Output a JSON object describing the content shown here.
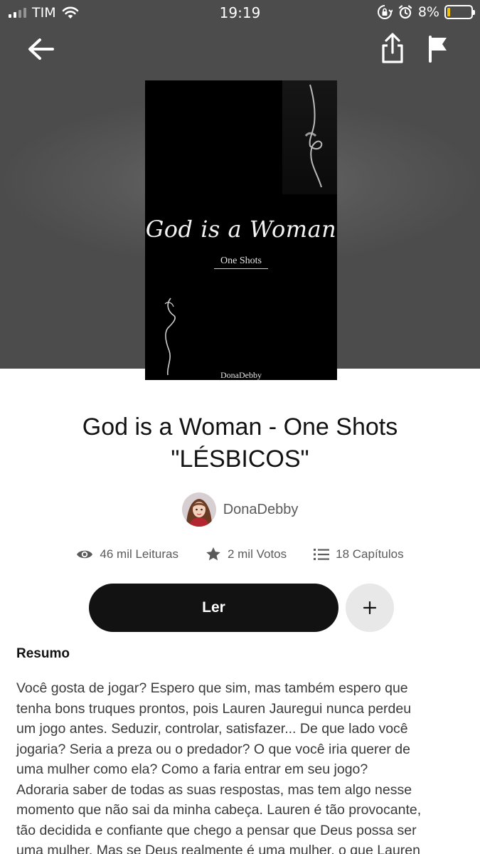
{
  "status_bar": {
    "carrier": "TIM",
    "time": "19:19",
    "battery_percent": "8%",
    "battery_level": 0.08,
    "signal_bars": 2,
    "accent_battery": "#f2c200"
  },
  "toolbar": {
    "back_icon": "arrow-left-icon",
    "share_icon": "share-icon",
    "report_icon": "flag-icon"
  },
  "cover": {
    "title": "God is a Woman",
    "subtitle": "One Shots",
    "author": "DonaDebby"
  },
  "story": {
    "title_lines": [
      "God is a Woman - One Shots",
      "\"LÉSBICOS\""
    ]
  },
  "author": {
    "name": "DonaDebby"
  },
  "stats": {
    "reads": "46 mil Leituras",
    "votes": "2 mil Votos",
    "chapters": "18 Capítulos"
  },
  "actions": {
    "read_label": "Ler",
    "add_label": "+"
  },
  "summary": {
    "heading": "Resumo",
    "lines": [
      "Você gosta de jogar? Espero que sim, mas também espero que",
      "tenha bons truques prontos, pois Lauren Jauregui nunca perdeu",
      "um jogo antes. Seduzir, controlar, satisfazer... De que lado você",
      "jogaria? Seria a preza ou o predador? O que você iria querer de",
      "uma mulher como ela? Como a faria entrar em seu jogo?",
      "Adoraria saber de todas as suas respostas, mas tem algo nesse",
      "momento que não sai da minha cabeça. Lauren é tão provocante,",
      "tão decidida e confiante que chego a pensar que Deus possa ser",
      "uma mulher. Mas se Deus realmente é uma mulher, o que Lauren"
    ]
  }
}
